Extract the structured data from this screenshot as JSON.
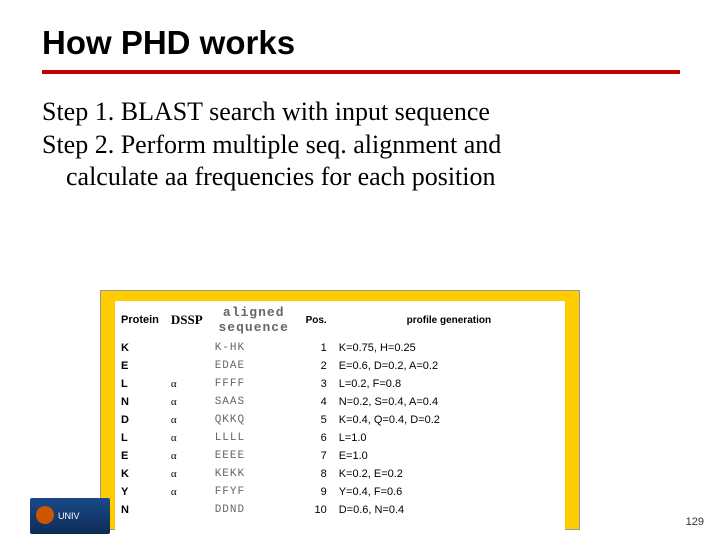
{
  "title": "How PHD works",
  "step1": "Step 1. BLAST search with input sequence",
  "step2a": "Step 2. Perform multiple seq. alignment and",
  "step2b": "calculate aa frequencies for each position",
  "table": {
    "headers": {
      "protein": "Protein",
      "dssp": "DSSP",
      "aligned": "aligned sequence",
      "pos": "Pos.",
      "profile": "profile generation"
    },
    "rows": [
      {
        "protein": "K",
        "dssp": "",
        "aligned": "K-HK",
        "pos": "1",
        "profile": "K=0.75, H=0.25"
      },
      {
        "protein": "E",
        "dssp": "",
        "aligned": "EDAE",
        "pos": "2",
        "profile": "E=0.6, D=0.2, A=0.2"
      },
      {
        "protein": "L",
        "dssp": "α",
        "aligned": "FFFF",
        "pos": "3",
        "profile": "L=0.2, F=0.8"
      },
      {
        "protein": "N",
        "dssp": "α",
        "aligned": "SAAS",
        "pos": "4",
        "profile": "N=0.2, S=0.4, A=0.4"
      },
      {
        "protein": "D",
        "dssp": "α",
        "aligned": "QKKQ",
        "pos": "5",
        "profile": "K=0.4, Q=0.4, D=0.2"
      },
      {
        "protein": "L",
        "dssp": "α",
        "aligned": "LLLL",
        "pos": "6",
        "profile": "L=1.0"
      },
      {
        "protein": "E",
        "dssp": "α",
        "aligned": "EEEE",
        "pos": "7",
        "profile": "E=1.0"
      },
      {
        "protein": "K",
        "dssp": "α",
        "aligned": "KEKK",
        "pos": "8",
        "profile": "K=0.2, E=0.2"
      },
      {
        "protein": "Y",
        "dssp": "α",
        "aligned": "FFYF",
        "pos": "9",
        "profile": "Y=0.4, F=0.6"
      },
      {
        "protein": "N",
        "dssp": "",
        "aligned": "DDND",
        "pos": "10",
        "profile": "D=0.6, N=0.4"
      }
    ]
  },
  "logo_text": "UNIV",
  "page_number": "129"
}
